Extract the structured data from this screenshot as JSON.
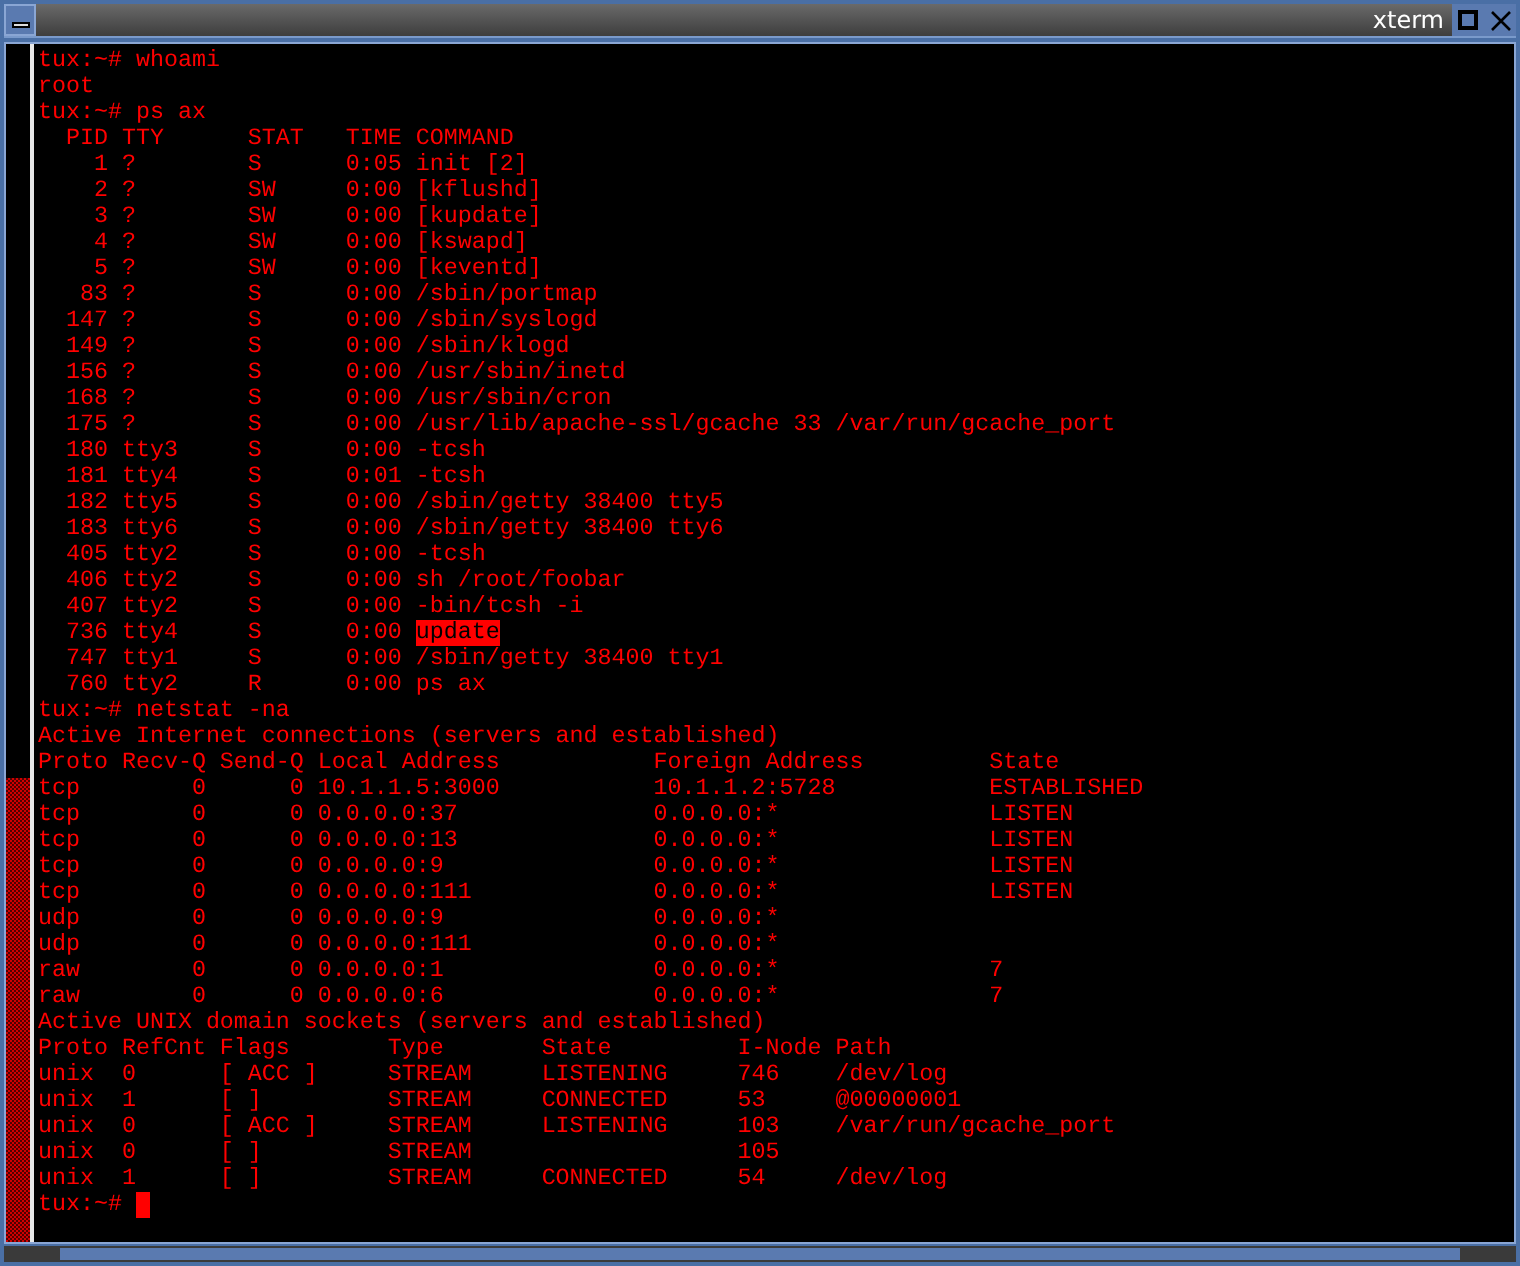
{
  "window": {
    "title": "xterm"
  },
  "terminal": {
    "cursor": true,
    "lines": [
      {
        "text": "tux:~# whoami"
      },
      {
        "text": "root"
      },
      {
        "text": "tux:~# ps ax"
      },
      {
        "text": "  PID TTY      STAT   TIME COMMAND"
      },
      {
        "text": "    1 ?        S      0:05 init [2]"
      },
      {
        "text": "    2 ?        SW     0:00 [kflushd]"
      },
      {
        "text": "    3 ?        SW     0:00 [kupdate]"
      },
      {
        "text": "    4 ?        SW     0:00 [kswapd]"
      },
      {
        "text": "    5 ?        SW     0:00 [keventd]"
      },
      {
        "text": "   83 ?        S      0:00 /sbin/portmap"
      },
      {
        "text": "  147 ?        S      0:00 /sbin/syslogd"
      },
      {
        "text": "  149 ?        S      0:00 /sbin/klogd"
      },
      {
        "text": "  156 ?        S      0:00 /usr/sbin/inetd"
      },
      {
        "text": "  168 ?        S      0:00 /usr/sbin/cron"
      },
      {
        "text": "  175 ?        S      0:00 /usr/lib/apache-ssl/gcache 33 /var/run/gcache_port"
      },
      {
        "text": "  180 tty3     S      0:00 -tcsh"
      },
      {
        "text": "  181 tty4     S      0:01 -tcsh"
      },
      {
        "text": "  182 tty5     S      0:00 /sbin/getty 38400 tty5"
      },
      {
        "text": "  183 tty6     S      0:00 /sbin/getty 38400 tty6"
      },
      {
        "text": "  405 tty2     S      0:00 -tcsh"
      },
      {
        "text": "  406 tty2     S      0:00 sh /root/foobar"
      },
      {
        "text": "  407 tty2     S      0:00 -bin/tcsh -i"
      },
      {
        "text": "  736 tty4     S      0:00 ",
        "selection": "update"
      },
      {
        "text": "  747 tty1     S      0:00 /sbin/getty 38400 tty1"
      },
      {
        "text": "  760 tty2     R      0:00 ps ax"
      },
      {
        "text": "tux:~# netstat -na"
      },
      {
        "text": "Active Internet connections (servers and established)"
      },
      {
        "text": "Proto Recv-Q Send-Q Local Address           Foreign Address         State"
      },
      {
        "text": "tcp        0      0 10.1.1.5:3000           10.1.1.2:5728           ESTABLISHED"
      },
      {
        "text": "tcp        0      0 0.0.0.0:37              0.0.0.0:*               LISTEN"
      },
      {
        "text": "tcp        0      0 0.0.0.0:13              0.0.0.0:*               LISTEN"
      },
      {
        "text": "tcp        0      0 0.0.0.0:9               0.0.0.0:*               LISTEN"
      },
      {
        "text": "tcp        0      0 0.0.0.0:111             0.0.0.0:*               LISTEN"
      },
      {
        "text": "udp        0      0 0.0.0.0:9               0.0.0.0:*"
      },
      {
        "text": "udp        0      0 0.0.0.0:111             0.0.0.0:*"
      },
      {
        "text": "raw        0      0 0.0.0.0:1               0.0.0.0:*               7"
      },
      {
        "text": "raw        0      0 0.0.0.0:6               0.0.0.0:*               7"
      },
      {
        "text": "Active UNIX domain sockets (servers and established)"
      },
      {
        "text": "Proto RefCnt Flags       Type       State         I-Node Path"
      },
      {
        "text": "unix  0      [ ACC ]     STREAM     LISTENING     746    /dev/log"
      },
      {
        "text": "unix  1      [ ]         STREAM     CONNECTED     53     @00000001"
      },
      {
        "text": "unix  0      [ ACC ]     STREAM     LISTENING     103    /var/run/gcache_port"
      },
      {
        "text": "unix  0      [ ]         STREAM                   105"
      },
      {
        "text": "unix  1      [ ]         STREAM     CONNECTED     54     /dev/log"
      },
      {
        "text": "tux:~# "
      }
    ]
  }
}
